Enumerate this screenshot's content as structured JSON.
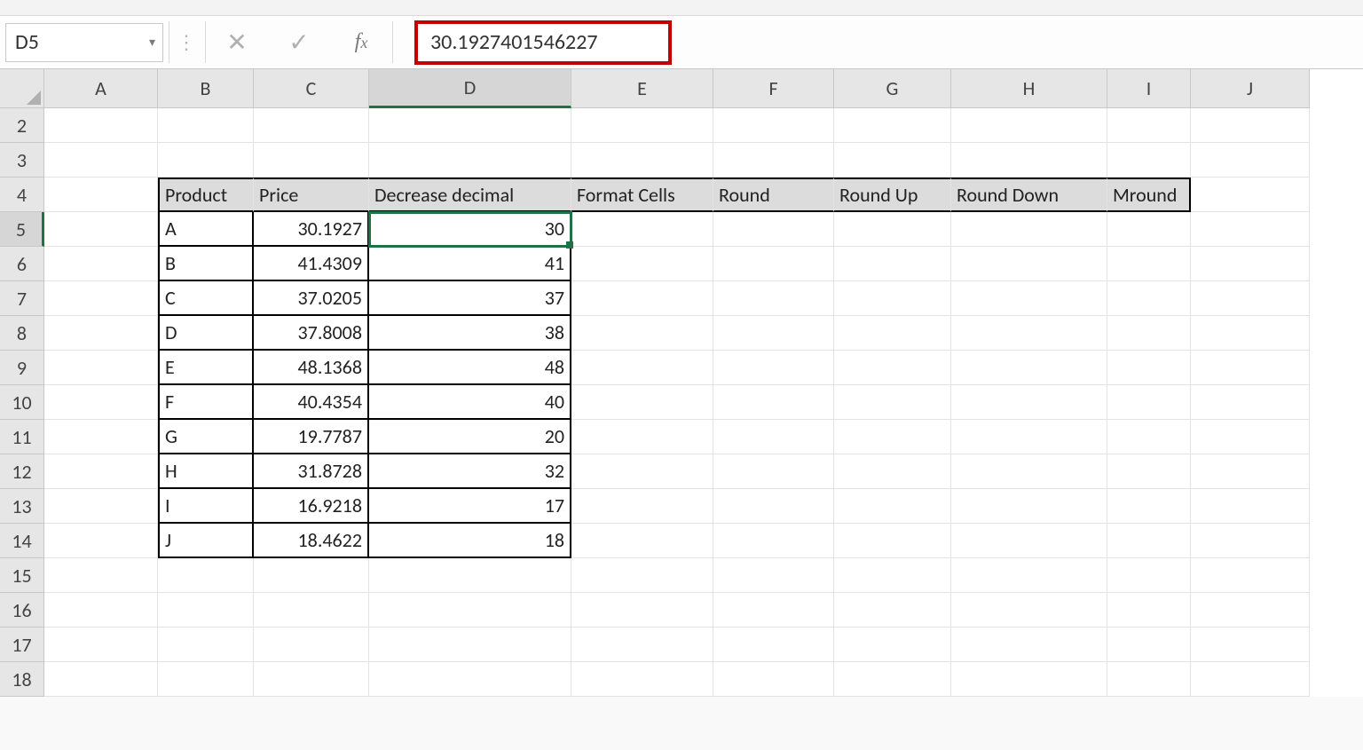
{
  "name_box": "D5",
  "formula_value": "30.1927401546227",
  "columns": [
    "A",
    "B",
    "C",
    "D",
    "E",
    "F",
    "G",
    "H",
    "I",
    "J"
  ],
  "row_numbers": [
    2,
    3,
    4,
    5,
    6,
    7,
    8,
    9,
    10,
    11,
    12,
    13,
    14,
    15,
    16,
    17,
    18
  ],
  "active_col": "D",
  "active_row": 5,
  "table": {
    "headers": {
      "product": "Product",
      "price": "Price",
      "decrease_decimal": "Decrease decimal",
      "format_cells": "Format Cells",
      "round": "Round",
      "round_up": "Round Up",
      "round_down": "Round Down",
      "mround": "Mround"
    },
    "rows": [
      {
        "product": "A",
        "price": "30.1927",
        "dec": "30"
      },
      {
        "product": "B",
        "price": "41.4309",
        "dec": "41"
      },
      {
        "product": "C",
        "price": "37.0205",
        "dec": "37"
      },
      {
        "product": "D",
        "price": "37.8008",
        "dec": "38"
      },
      {
        "product": "E",
        "price": "48.1368",
        "dec": "48"
      },
      {
        "product": "F",
        "price": "40.4354",
        "dec": "40"
      },
      {
        "product": "G",
        "price": "19.7787",
        "dec": "20"
      },
      {
        "product": "H",
        "price": "31.8728",
        "dec": "32"
      },
      {
        "product": "I",
        "price": "16.9218",
        "dec": "17"
      },
      {
        "product": "J",
        "price": "18.4622",
        "dec": "18"
      }
    ]
  }
}
